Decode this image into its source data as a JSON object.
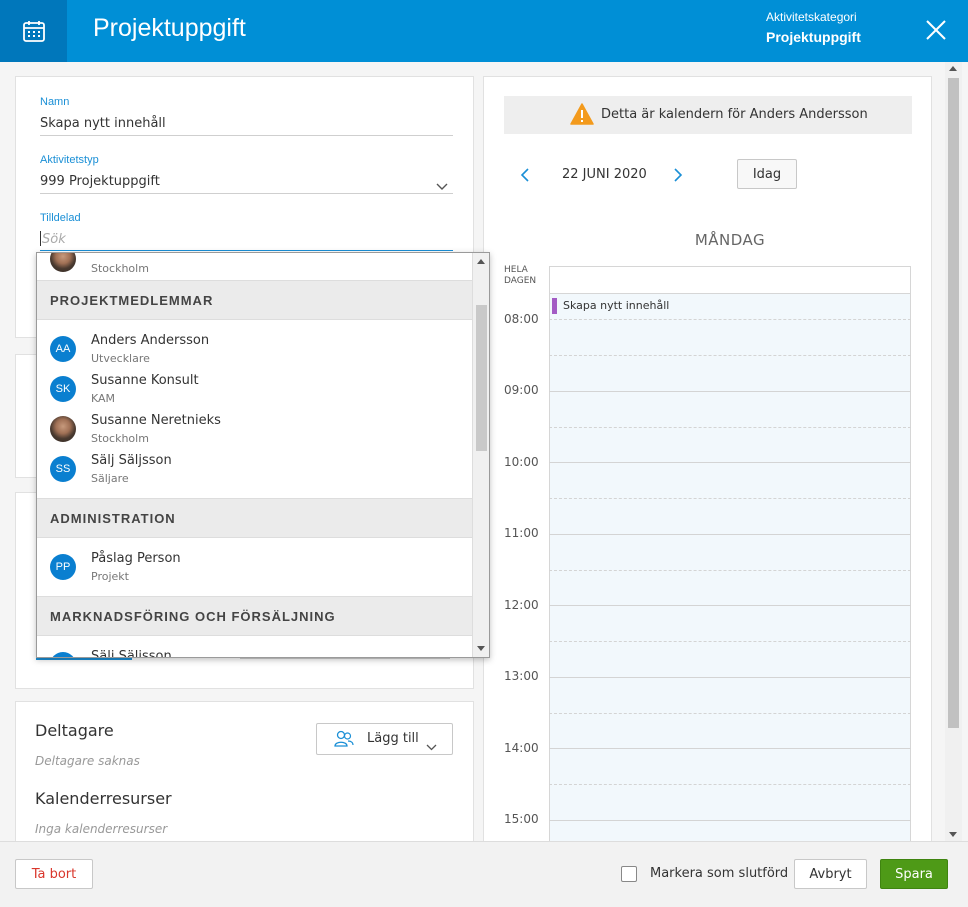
{
  "header": {
    "title": "Projektuppgift",
    "category_label": "Aktivitetskategori",
    "category_value": "Projektuppgift"
  },
  "form": {
    "name_label": "Namn",
    "name_value": "Skapa nytt innehåll",
    "type_label": "Aktivitetstyp",
    "type_value": "999 Projektuppgift",
    "assigned_label": "Tilldelad",
    "assigned_placeholder": "Sök"
  },
  "dropdown": {
    "top_partial_sub": "Stockholm",
    "groups": [
      {
        "label": "PROJEKTMEDLEMMAR",
        "members": [
          {
            "initials": "AA",
            "name": "Anders Andersson",
            "role": "Utvecklare"
          },
          {
            "initials": "SK",
            "name": "Susanne Konsult",
            "role": "KAM"
          },
          {
            "initials": "",
            "name": "Susanne Neretnieks",
            "role": "Stockholm"
          },
          {
            "initials": "SS",
            "name": "Sälj Säljsson",
            "role": "Säljare"
          }
        ]
      },
      {
        "label": "ADMINISTRATION",
        "members": [
          {
            "initials": "PP",
            "name": "Påslag Person",
            "role": "Projekt"
          }
        ]
      },
      {
        "label": "MARKNADSFÖRING OCH FÖRSÄLJNING",
        "members": [
          {
            "initials": "",
            "name": "Sälj Säljsson",
            "role": ""
          }
        ]
      }
    ]
  },
  "participants": {
    "title": "Deltagare",
    "empty": "Deltagare saknas",
    "add_label": "Lägg till"
  },
  "resources": {
    "title": "Kalenderresurser",
    "empty": "Inga kalenderresurser"
  },
  "calendar": {
    "notice": "Detta är kalendern för Anders Andersson",
    "date": "22 JUNI 2020",
    "today_label": "Idag",
    "day_name": "MÅNDAG",
    "allday_line1": "HELA",
    "allday_line2": "DAGEN",
    "event_title": "Skapa nytt innehåll",
    "event_color": "#a35bc4",
    "hours": [
      "08:00",
      "09:00",
      "10:00",
      "11:00",
      "12:00",
      "13:00",
      "14:00",
      "15:00"
    ]
  },
  "footer": {
    "delete_label": "Ta bort",
    "mark_done_label": "Markera som slutförd",
    "cancel_label": "Avbryt",
    "save_label": "Spara"
  },
  "colors": {
    "header": "#008fd6",
    "accent": "#1a8fd6",
    "save": "#4e9a17",
    "danger": "#d9362b"
  }
}
